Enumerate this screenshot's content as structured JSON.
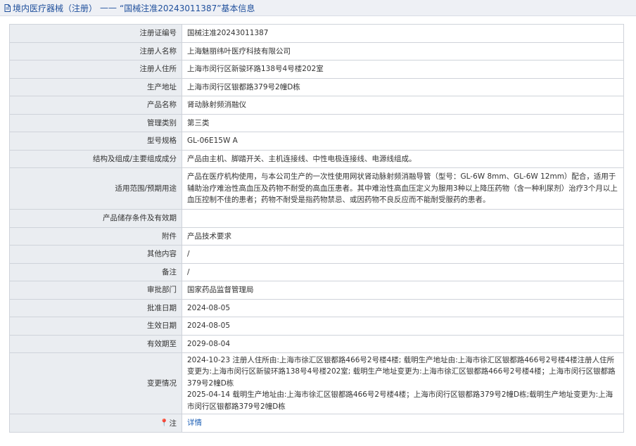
{
  "header": {
    "title_left": "境内医疗器械（注册）",
    "dash": "——",
    "title_right": "“国械注准20243011387”基本信息"
  },
  "rows": [
    {
      "label": "注册证编号",
      "value": "国械注准20243011387"
    },
    {
      "label": "注册人名称",
      "value": "上海魅丽纬叶医疗科技有限公司"
    },
    {
      "label": "注册人住所",
      "value": "上海市闵行区新骏环路138号4号楼202室"
    },
    {
      "label": "生产地址",
      "value": "上海市闵行区银都路379号2幢D栋"
    },
    {
      "label": "产品名称",
      "value": "肾动脉射频消融仪"
    },
    {
      "label": "管理类别",
      "value": "第三类"
    },
    {
      "label": "型号规格",
      "value": "GL-06E15W A"
    },
    {
      "label": "结构及组成/主要组成成分",
      "value": "产品由主机、脚踏开关、主机连接线、中性电极连接线、电源线组成。"
    },
    {
      "label": "适用范围/预期用途",
      "value": "产品在医疗机构使用，与本公司生产的一次性使用网状肾动脉射频消融导管（型号：GL-6W 8mm、GL-6W 12mm）配合，适用于辅助治疗难治性高血压及药物不耐受的高血压患者。其中难治性高血压定义为服用3种以上降压药物（含一种利尿剂）治疗3个月以上血压控制不佳的患者；药物不耐受是指药物禁忌、或因药物不良反应而不能耐受服药的患者。"
    },
    {
      "label": "产品储存条件及有效期",
      "value": ""
    },
    {
      "label": "附件",
      "value": "产品技术要求"
    },
    {
      "label": "其他内容",
      "value": "/"
    },
    {
      "label": "备注",
      "value": "/"
    },
    {
      "label": "审批部门",
      "value": "国家药品监督管理局"
    },
    {
      "label": "批准日期",
      "value": "2024-08-05"
    },
    {
      "label": "生效日期",
      "value": "2024-08-05"
    },
    {
      "label": "有效期至",
      "value": "2029-08-04"
    },
    {
      "label": "变更情况",
      "value_lines": [
        "2024-10-23 注册人住所由:上海市徐汇区银都路466号2号楼4楼; 载明生产地址由:上海市徐汇区银都路466号2号楼4楼注册人住所变更为:上海市闵行区新骏环路138号4号楼202室; 载明生产地址变更为:上海市徐汇区银都路466号2号楼4楼；上海市闵行区银都路379号2幢D栋",
        "2025-04-14 载明生产地址由:上海市徐汇区银都路466号2号楼4楼；上海市闵行区银都路379号2幢D栋;载明生产地址变更为:上海市闵行区银都路379号2幢D栋"
      ]
    },
    {
      "label": "注",
      "value": "详情"
    }
  ]
}
